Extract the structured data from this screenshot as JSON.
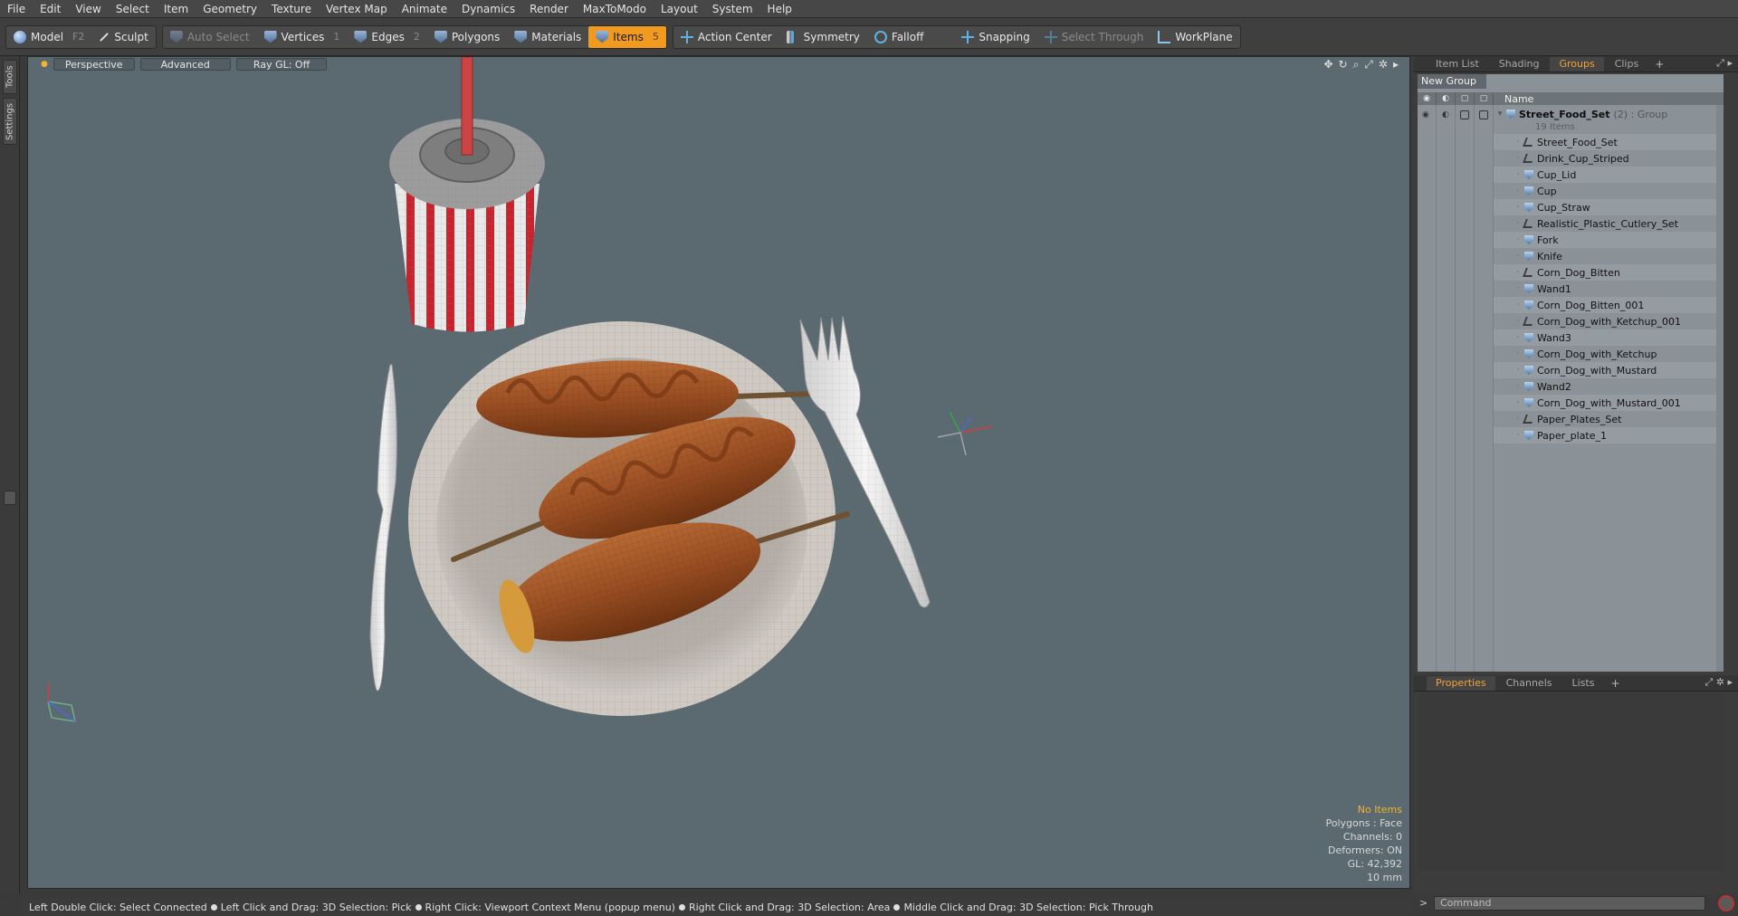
{
  "menu": [
    "File",
    "Edit",
    "View",
    "Select",
    "Item",
    "Geometry",
    "Texture",
    "Vertex Map",
    "Animate",
    "Dynamics",
    "Render",
    "MaxToModo",
    "Layout",
    "System",
    "Help"
  ],
  "toolbar": {
    "model": "Model",
    "model_key": "F2",
    "sculpt": "Sculpt",
    "auto_select": "Auto Select",
    "vertices": "Vertices",
    "vertices_key": "1",
    "edges": "Edges",
    "edges_key": "2",
    "polygons": "Polygons",
    "materials": "Materials",
    "items": "Items",
    "items_key": "5",
    "action_center": "Action Center",
    "symmetry": "Symmetry",
    "falloff": "Falloff",
    "snapping": "Snapping",
    "select_through": "Select Through",
    "workplane": "WorkPlane"
  },
  "left_tabs": [
    "Tools",
    "Settings"
  ],
  "viewport": {
    "buttons": [
      "Perspective",
      "Advanced",
      "Ray GL: Off"
    ],
    "info": {
      "selection": "No Items",
      "polygons": "Polygons : Face",
      "channels": "Channels: 0",
      "deformers": "Deformers: ON",
      "gl": "GL: 42,392",
      "scale": "10 mm"
    },
    "accent_color": "#f2b233"
  },
  "right_panel": {
    "top_tabs": [
      "Item List",
      "Shading",
      "Groups",
      "Clips"
    ],
    "active_top_tab": "Groups",
    "new_group": "New Group",
    "name_col": "Name",
    "root": {
      "name": "Street_Food_Set",
      "suffix": "(2) : Group",
      "count": "19 Items"
    },
    "items": [
      {
        "name": "Street_Food_Set",
        "icon": "locator-icon"
      },
      {
        "name": "Drink_Cup_Striped",
        "icon": "locator-icon"
      },
      {
        "name": "Cup_Lid",
        "icon": "mesh-icon"
      },
      {
        "name": "Cup",
        "icon": "mesh-icon"
      },
      {
        "name": "Cup_Straw",
        "icon": "mesh-icon"
      },
      {
        "name": "Realistic_Plastic_Cutlery_Set",
        "icon": "locator-icon"
      },
      {
        "name": "Fork",
        "icon": "mesh-icon"
      },
      {
        "name": "Knife",
        "icon": "mesh-icon"
      },
      {
        "name": "Corn_Dog_Bitten",
        "icon": "locator-icon"
      },
      {
        "name": "Wand1",
        "icon": "mesh-icon"
      },
      {
        "name": "Corn_Dog_Bitten_001",
        "icon": "mesh-icon"
      },
      {
        "name": "Corn_Dog_with_Ketchup_001",
        "icon": "locator-icon"
      },
      {
        "name": "Wand3",
        "icon": "mesh-icon"
      },
      {
        "name": "Corn_Dog_with_Ketchup",
        "icon": "mesh-icon"
      },
      {
        "name": "Corn_Dog_with_Mustard",
        "icon": "mesh-icon"
      },
      {
        "name": "Wand2",
        "icon": "mesh-icon"
      },
      {
        "name": "Corn_Dog_with_Mustard_001",
        "icon": "mesh-icon"
      },
      {
        "name": "Paper_Plates_Set",
        "icon": "locator-icon"
      },
      {
        "name": "Paper_plate_1",
        "icon": "mesh-icon"
      }
    ],
    "bottom_tabs": [
      "Properties",
      "Channels",
      "Lists"
    ],
    "active_bottom_tab": "Properties",
    "command_placeholder": "Command"
  },
  "status": [
    "Left Double Click: Select Connected",
    "Left Click and Drag: 3D Selection: Pick",
    "Right Click: Viewport Context Menu (popup menu)",
    "Right Click and Drag: 3D Selection: Area",
    "Middle Click and Drag: 3D Selection: Pick Through"
  ]
}
